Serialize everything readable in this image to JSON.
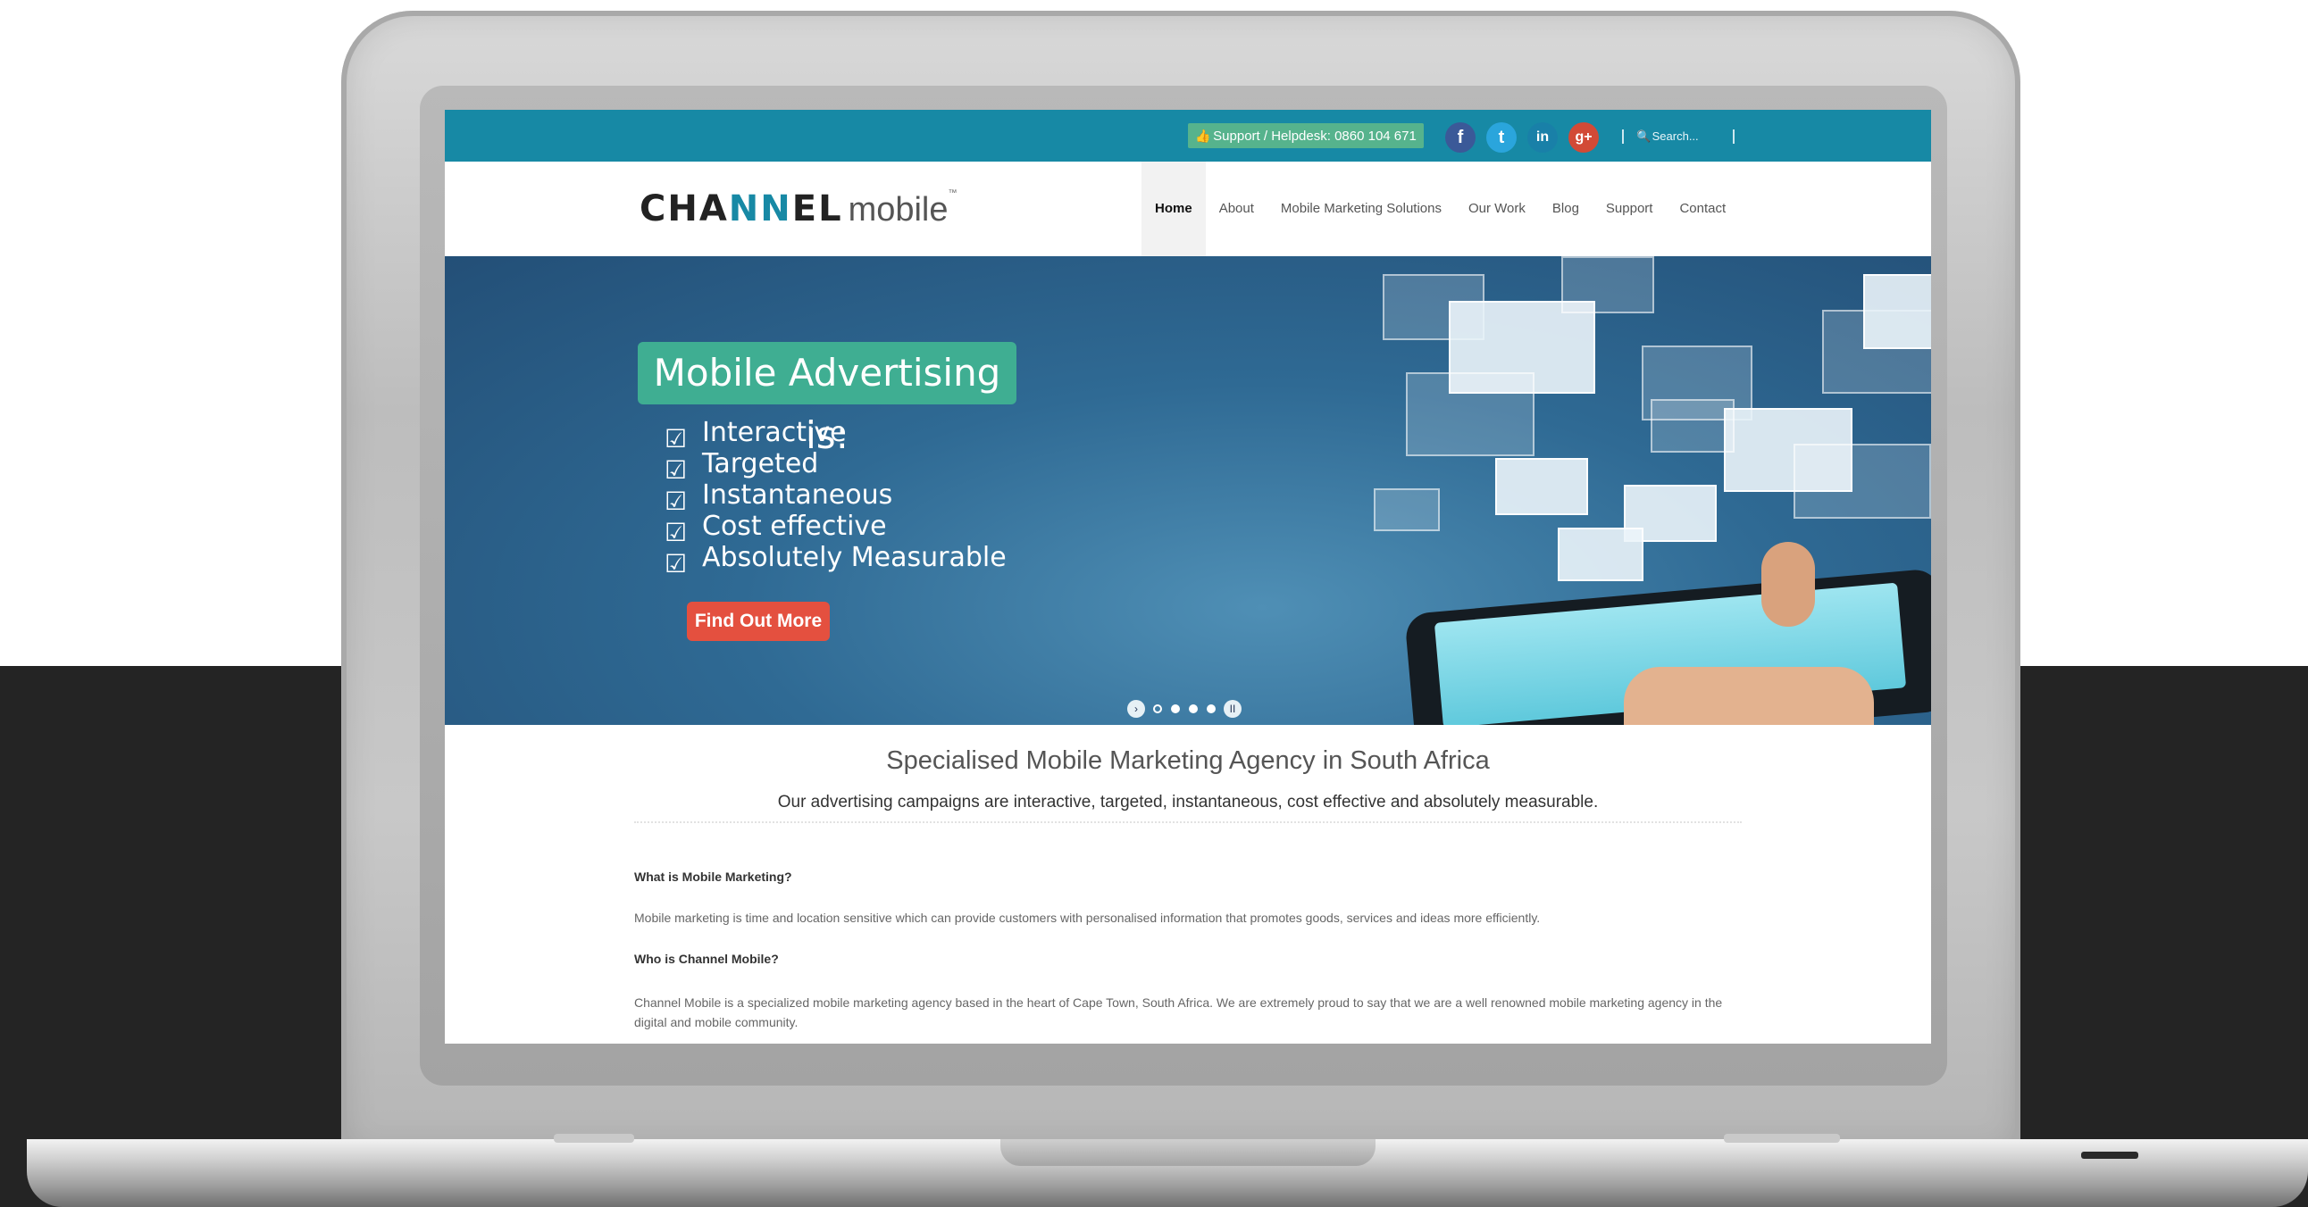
{
  "topbar": {
    "helpdesk_text": "Support / Helpdesk: 0860 104 671",
    "social_icons": [
      "facebook-icon",
      "twitter-icon",
      "linkedin-icon",
      "google-plus-icon"
    ],
    "search_placeholder": "Search...",
    "background_color": "#1789a5"
  },
  "header": {
    "logo_part1": "CHA",
    "logo_part2": "NN",
    "logo_part3": "EL",
    "logo_part4": "mobile",
    "nav": [
      {
        "label": "Home",
        "active": true
      },
      {
        "label": "About"
      },
      {
        "label": "Mobile Marketing Solutions"
      },
      {
        "label": "Our Work"
      },
      {
        "label": "Blog"
      },
      {
        "label": "Support"
      },
      {
        "label": "Contact"
      }
    ]
  },
  "hero": {
    "title": "Mobile Advertising is:",
    "items": [
      "Interactive",
      "Targeted",
      "Instantaneous",
      "Cost effective",
      "Absolutely Measurable"
    ],
    "cta_label": "Find Out More",
    "slider_dot_count": 4,
    "accent_color": "#3fae92",
    "cta_color": "#e4503f"
  },
  "content": {
    "headline": "Specialised Mobile Marketing Agency in South Africa",
    "subline": "Our advertising campaigns are interactive, targeted, instantaneous, cost effective and absolutely measurable.",
    "q1": "What is Mobile Marketing?",
    "p1": "Mobile marketing is time and location sensitive which can provide customers with personalised information that promotes goods, services and ideas more efficiently.",
    "q2": "Who is Channel Mobile?",
    "p2": "Channel Mobile is a specialized mobile marketing agency based in the heart of Cape Town, South Africa. We are extremely proud to say that we are a well renowned mobile marketing agency in the digital and mobile community."
  }
}
